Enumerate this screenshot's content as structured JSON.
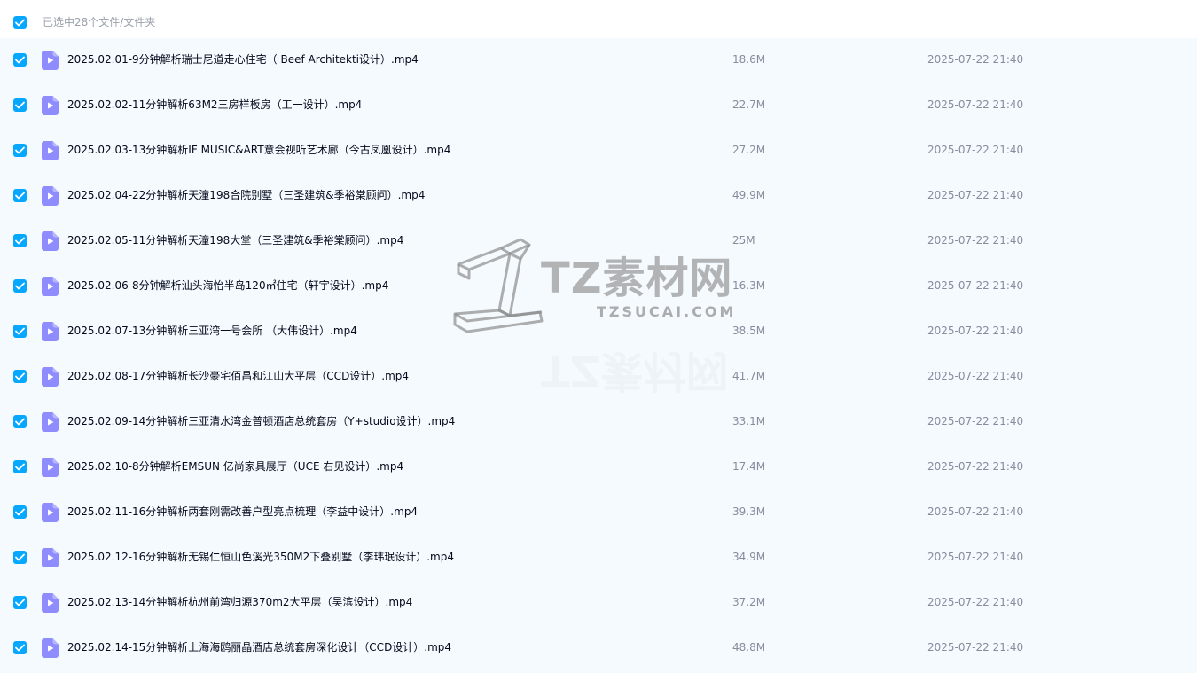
{
  "header": {
    "selection_text": "已选中28个文件/文件夹"
  },
  "watermark": {
    "title": "TZ素材网",
    "subtitle": "TZSUCAI.COM"
  },
  "colors": {
    "accent": "#06a7ff",
    "video_icon": "#8f8cff",
    "row_bg": "#f5faff"
  },
  "files": [
    {
      "name": "2025.02.01-9分钟解析瑞士尼道走心住宅（ Beef Architekti设计）.mp4",
      "size": "18.6M",
      "date": "2025-07-22 21:40"
    },
    {
      "name": "2025.02.02-11分钟解析63M2三房样板房（工一设计）.mp4",
      "size": "22.7M",
      "date": "2025-07-22 21:40"
    },
    {
      "name": "2025.02.03-13分钟解析IF MUSIC&ART意会视听艺术廊（今古凤凰设计）.mp4",
      "size": "27.2M",
      "date": "2025-07-22 21:40"
    },
    {
      "name": "2025.02.04-22分钟解析天潼198合院别墅（三圣建筑&季裕棠顾问）.mp4",
      "size": "49.9M",
      "date": "2025-07-22 21:40"
    },
    {
      "name": "2025.02.05-11分钟解析天潼198大堂（三圣建筑&季裕棠顾问）.mp4",
      "size": "25M",
      "date": "2025-07-22 21:40"
    },
    {
      "name": "2025.02.06-8分钟解析汕头海怡半岛120㎡住宅（轩宇设计）.mp4",
      "size": "16.3M",
      "date": "2025-07-22 21:40"
    },
    {
      "name": "2025.02.07-13分钟解析三亚湾一号会所 （大伟设计）.mp4",
      "size": "38.5M",
      "date": "2025-07-22 21:40"
    },
    {
      "name": "2025.02.08-17分钟解析长沙豪宅佰昌和江山大平层（CCD设计）.mp4",
      "size": "41.7M",
      "date": "2025-07-22 21:40"
    },
    {
      "name": "2025.02.09-14分钟解析三亚清水湾金普顿酒店总统套房（Y+studio设计）.mp4",
      "size": "33.1M",
      "date": "2025-07-22 21:40"
    },
    {
      "name": "2025.02.10-8分钟解析EMSUN 亿尚家具展厅（UCE 右见设计）.mp4",
      "size": "17.4M",
      "date": "2025-07-22 21:40"
    },
    {
      "name": "2025.02.11-16分钟解析两套刚需改善户型亮点梳理（李益中设计）.mp4",
      "size": "39.3M",
      "date": "2025-07-22 21:40"
    },
    {
      "name": "2025.02.12-16分钟解析无锡仁恒山色溪光350M2下叠别墅（李玮珉设计）.mp4",
      "size": "34.9M",
      "date": "2025-07-22 21:40"
    },
    {
      "name": "2025.02.13-14分钟解析杭州前湾归源370m2大平层（吴滨设计）.mp4",
      "size": "37.2M",
      "date": "2025-07-22 21:40"
    },
    {
      "name": "2025.02.14-15分钟解析上海海鸥丽晶酒店总统套房深化设计（CCD设计）.mp4",
      "size": "48.8M",
      "date": "2025-07-22 21:40"
    }
  ]
}
